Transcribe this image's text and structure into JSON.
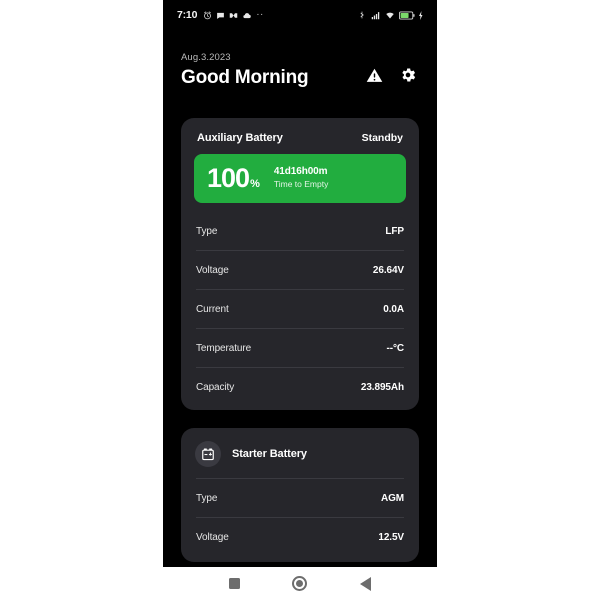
{
  "statusbar": {
    "time": "7:10",
    "left_icons": [
      "alarm-icon",
      "chat-bubble-icon",
      "envelope-icon",
      "cloud-icon"
    ],
    "overflow": "··",
    "right_icons": [
      "bluetooth-icon",
      "signal-bars-icon",
      "wifi-icon",
      "battery-charging-icon"
    ]
  },
  "header": {
    "date": "Aug.3.2023",
    "greeting": "Good Morning",
    "warning_icon": "warning-triangle-icon",
    "settings_icon": "gear-icon"
  },
  "auxiliary": {
    "title": "Auxiliary Battery",
    "status": "Standby",
    "gauge": {
      "percent": "100",
      "percent_unit": "%",
      "time_to_empty": "41d16h00m",
      "time_to_empty_label": "Time to Empty",
      "fill_color": "#22ad3f",
      "fill_ratio": 100
    },
    "rows": [
      {
        "label": "Type",
        "value": "LFP"
      },
      {
        "label": "Voltage",
        "value": "26.64V"
      },
      {
        "label": "Current",
        "value": "0.0A"
      },
      {
        "label": "Temperature",
        "value": "--°C"
      },
      {
        "label": "Capacity",
        "value": "23.895Ah"
      }
    ]
  },
  "starter": {
    "title": "Starter Battery",
    "icon": "car-battery-icon",
    "rows": [
      {
        "label": "Type",
        "value": "AGM"
      },
      {
        "label": "Voltage",
        "value": "12.5V"
      }
    ]
  },
  "navbar": {
    "recents": "recents-square-icon",
    "home": "home-circle-icon",
    "back": "back-triangle-icon"
  },
  "colors": {
    "page_background": "#000000",
    "card_background": "#26262b",
    "accent_green": "#22ad3f",
    "divider": "#3a3a40"
  }
}
